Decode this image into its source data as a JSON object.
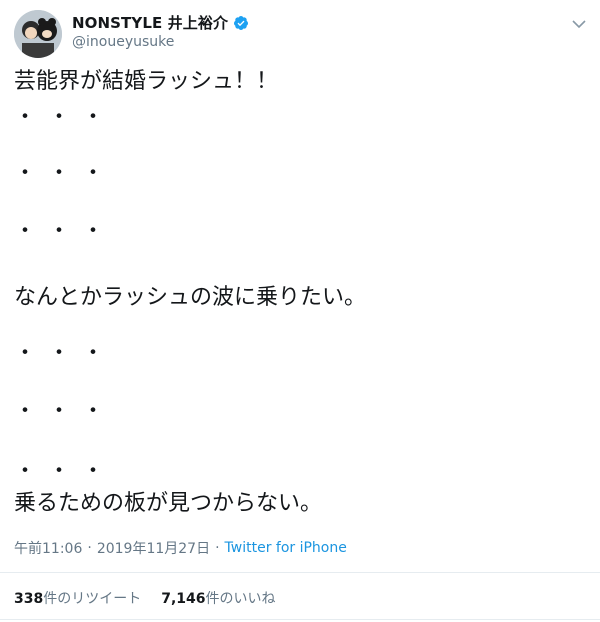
{
  "user": {
    "display_name": "NONSTYLE 井上裕介",
    "handle": "@inoueyusuke",
    "verified_icon": "verified-badge-icon",
    "verified_color": "#1da1f2"
  },
  "tweet": {
    "lines": [
      "芸能界が結婚ラッシュ！！",
      "・・・",
      "・・・",
      "・・・",
      "なんとかラッシュの波に乗りたい。",
      "・・・",
      "・・・",
      "・・・",
      "乗るための板が見つからない。"
    ]
  },
  "meta": {
    "time": "午前11:06",
    "separator": "·",
    "date": "2019年11月27日",
    "separator2": "·",
    "source": "Twitter for iPhone"
  },
  "stats": {
    "retweet_count": "338",
    "retweet_label": "件のリツイート",
    "like_count": "7,146",
    "like_label": "件のいいね"
  },
  "colors": {
    "link": "#1b95e0",
    "muted": "#657786",
    "text": "#14171a"
  }
}
